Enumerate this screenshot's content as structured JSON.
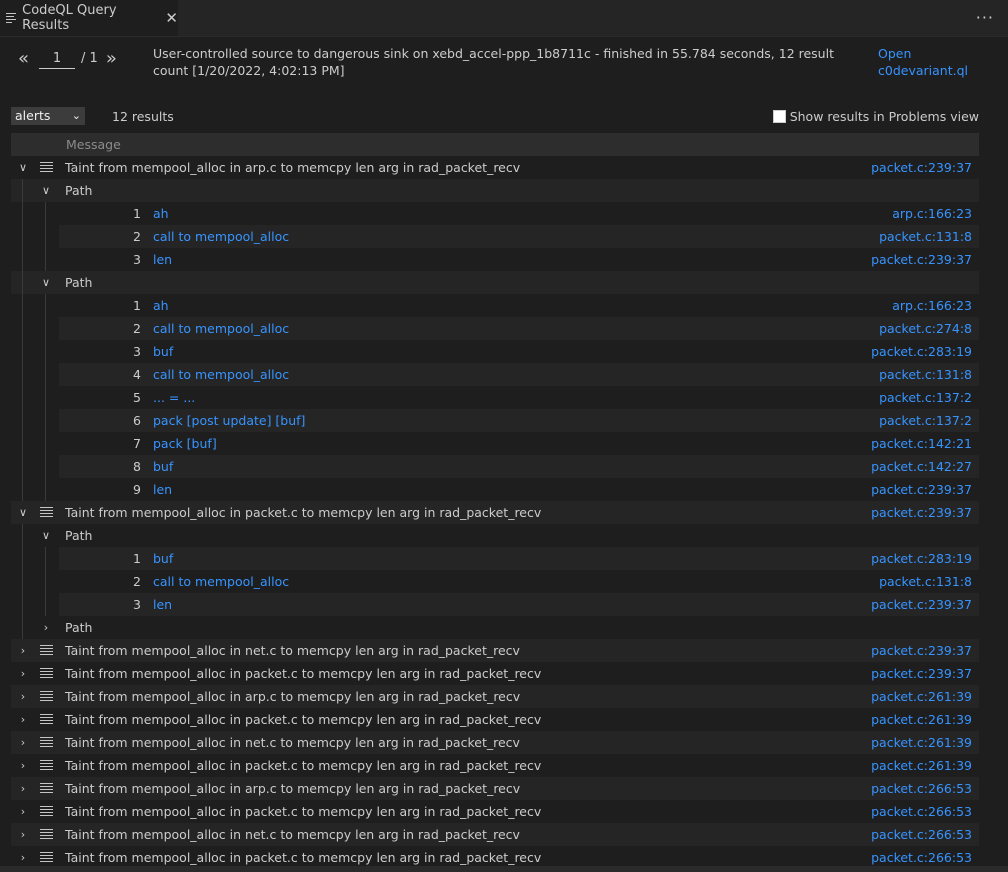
{
  "tab": {
    "title": "CodeQL Query Results",
    "more": "···"
  },
  "pager": {
    "prev": "«",
    "next": "»",
    "page": "1",
    "total": "/ 1"
  },
  "summary": "User-controlled source to dangerous sink on xebd_accel-ppp_1b8711c - finished in 55.784 seconds, 12 result count [1/20/2022, 4:02:13 PM]",
  "open_link": "Open c0devariant.ql",
  "select": {
    "value": "alerts"
  },
  "result_count": "12 results",
  "problems_checkbox": "Show results in Problems view",
  "table_header": "Message",
  "rows": [
    {
      "kind": "result",
      "expanded": true,
      "message": "Taint from mempool_alloc in arp.c to memcpy len arg in rad_packet_recv",
      "loc": "packet.c:239:37"
    },
    {
      "kind": "path",
      "expanded": true,
      "label": "Path"
    },
    {
      "kind": "step",
      "num": "1",
      "text": "ah",
      "loc": "arp.c:166:23"
    },
    {
      "kind": "step",
      "num": "2",
      "text": "call to mempool_alloc",
      "loc": "packet.c:131:8"
    },
    {
      "kind": "step",
      "num": "3",
      "text": "len",
      "loc": "packet.c:239:37"
    },
    {
      "kind": "path",
      "expanded": true,
      "label": "Path"
    },
    {
      "kind": "step",
      "num": "1",
      "text": "ah",
      "loc": "arp.c:166:23"
    },
    {
      "kind": "step",
      "num": "2",
      "text": "call to mempool_alloc",
      "loc": "packet.c:274:8"
    },
    {
      "kind": "step",
      "num": "3",
      "text": "buf",
      "loc": "packet.c:283:19"
    },
    {
      "kind": "step",
      "num": "4",
      "text": "call to mempool_alloc",
      "loc": "packet.c:131:8"
    },
    {
      "kind": "step",
      "num": "5",
      "text": "... = ...",
      "loc": "packet.c:137:2"
    },
    {
      "kind": "step",
      "num": "6",
      "text": "pack [post update] [buf]",
      "loc": "packet.c:137:2"
    },
    {
      "kind": "step",
      "num": "7",
      "text": "pack [buf]",
      "loc": "packet.c:142:21"
    },
    {
      "kind": "step",
      "num": "8",
      "text": "buf",
      "loc": "packet.c:142:27"
    },
    {
      "kind": "step",
      "num": "9",
      "text": "len",
      "loc": "packet.c:239:37"
    },
    {
      "kind": "result",
      "expanded": true,
      "message": "Taint from mempool_alloc in packet.c to memcpy len arg in rad_packet_recv",
      "loc": "packet.c:239:37"
    },
    {
      "kind": "path",
      "expanded": true,
      "label": "Path"
    },
    {
      "kind": "step",
      "num": "1",
      "text": "buf",
      "loc": "packet.c:283:19"
    },
    {
      "kind": "step",
      "num": "2",
      "text": "call to mempool_alloc",
      "loc": "packet.c:131:8"
    },
    {
      "kind": "step",
      "num": "3",
      "text": "len",
      "loc": "packet.c:239:37"
    },
    {
      "kind": "path",
      "expanded": false,
      "label": "Path"
    },
    {
      "kind": "result",
      "expanded": false,
      "message": "Taint from mempool_alloc in net.c to memcpy len arg in rad_packet_recv",
      "loc": "packet.c:239:37"
    },
    {
      "kind": "result",
      "expanded": false,
      "message": "Taint from mempool_alloc in packet.c to memcpy len arg in rad_packet_recv",
      "loc": "packet.c:239:37"
    },
    {
      "kind": "result",
      "expanded": false,
      "message": "Taint from mempool_alloc in arp.c to memcpy len arg in rad_packet_recv",
      "loc": "packet.c:261:39"
    },
    {
      "kind": "result",
      "expanded": false,
      "message": "Taint from mempool_alloc in packet.c to memcpy len arg in rad_packet_recv",
      "loc": "packet.c:261:39"
    },
    {
      "kind": "result",
      "expanded": false,
      "message": "Taint from mempool_alloc in net.c to memcpy len arg in rad_packet_recv",
      "loc": "packet.c:261:39"
    },
    {
      "kind": "result",
      "expanded": false,
      "message": "Taint from mempool_alloc in packet.c to memcpy len arg in rad_packet_recv",
      "loc": "packet.c:261:39"
    },
    {
      "kind": "result",
      "expanded": false,
      "message": "Taint from mempool_alloc in arp.c to memcpy len arg in rad_packet_recv",
      "loc": "packet.c:266:53"
    },
    {
      "kind": "result",
      "expanded": false,
      "message": "Taint from mempool_alloc in packet.c to memcpy len arg in rad_packet_recv",
      "loc": "packet.c:266:53"
    },
    {
      "kind": "result",
      "expanded": false,
      "message": "Taint from mempool_alloc in net.c to memcpy len arg in rad_packet_recv",
      "loc": "packet.c:266:53"
    },
    {
      "kind": "result",
      "expanded": false,
      "message": "Taint from mempool_alloc in packet.c to memcpy len arg in rad_packet_recv",
      "loc": "packet.c:266:53"
    }
  ]
}
